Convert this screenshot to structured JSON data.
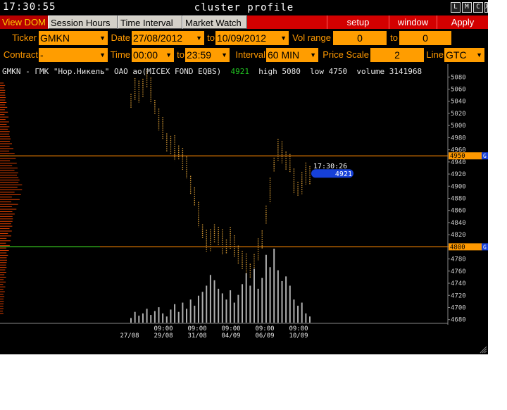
{
  "titlebar": {
    "clock": "17:30:55",
    "title": "cluster profile",
    "buttons": [
      "L",
      "M",
      "C",
      "X"
    ]
  },
  "menu": {
    "tabs": [
      "View DOM",
      "Session Hours",
      "Time Interval",
      "Market Watch"
    ],
    "right": [
      "setup",
      "window",
      "Apply"
    ]
  },
  "params": {
    "ticker_label": "Ticker",
    "ticker": "GMKN",
    "date_label": "Date",
    "date_from": "27/08/2012",
    "to_label": "to",
    "date_to": "10/09/2012",
    "vol_range_label": "Vol range",
    "vol_from": "0",
    "vol_to_label": "to",
    "vol_to": "0",
    "contract_label": "Contract",
    "contract": "-",
    "time_label": "Time",
    "time_from": "00:00",
    "time_to_label": "to",
    "time_to": "23:59",
    "interval_label": "Interval",
    "interval": "60 MIN",
    "price_scale_label": "Price Scale",
    "price_scale": "2",
    "line_label": "Line",
    "line": "GTC"
  },
  "info": {
    "instrument": "GMKN - ГМК \"Нор.Никель\" ОАО ао(MICEX FOND EQBS)",
    "last_price": "4921",
    "high_label": "high",
    "high": "5080",
    "low_label": "low",
    "low": "4750",
    "volume_label": "volume",
    "volume": "3141968"
  },
  "colors": {
    "accent": "#ff9900",
    "menu_red": "#d30000",
    "cursor_blue": "#1640d8",
    "line_orange": "#e07800",
    "green": "#20c020"
  },
  "chart_data": {
    "type": "line",
    "y_axis": {
      "ticks": [
        4680,
        4700,
        4720,
        4740,
        4760,
        4780,
        4800,
        4820,
        4840,
        4860,
        4880,
        4900,
        4920,
        4940,
        4960,
        4980,
        5000,
        5020,
        5040,
        5060,
        5080
      ],
      "range": [
        4675,
        5085
      ]
    },
    "x_tick_labels": [
      {
        "top": "",
        "bottom": "27/08"
      },
      {
        "top": "09:00",
        "bottom": "29/08"
      },
      {
        "top": "09:00",
        "bottom": "31/08"
      },
      {
        "top": "09:00",
        "bottom": "04/09"
      },
      {
        "top": "09:00",
        "bottom": "06/09"
      },
      {
        "top": "09:00",
        "bottom": "10/09"
      }
    ],
    "lines": [
      {
        "price": 4950,
        "label": "4950",
        "color": "#e07800"
      },
      {
        "price": 4800,
        "label": "4800",
        "color": "#e07800"
      }
    ],
    "cursor": {
      "time": "17:30:26",
      "price": "4921",
      "price_value": 4921
    },
    "grid_letter": "G",
    "price_series": [
      5040,
      5060,
      5050,
      5065,
      5075,
      5055,
      5030,
      5010,
      4990,
      4975,
      4965,
      4960,
      4955,
      4945,
      4925,
      4905,
      4880,
      4850,
      4825,
      4810,
      4805,
      4825,
      4815,
      4805,
      4800,
      4815,
      4795,
      4790,
      4775,
      4765,
      4760,
      4770,
      4790,
      4815,
      4850,
      4890,
      4935,
      4960,
      4950,
      4945,
      4935,
      4905,
      4895,
      4905,
      4915,
      4921
    ],
    "volume_series": [
      6,
      14,
      9,
      12,
      18,
      10,
      15,
      20,
      12,
      8,
      17,
      24,
      14,
      26,
      18,
      30,
      22,
      35,
      40,
      48,
      62,
      55,
      44,
      38,
      30,
      42,
      26,
      36,
      50,
      64,
      48,
      70,
      44,
      58,
      88,
      72,
      96,
      68,
      54,
      60,
      48,
      30,
      22,
      26,
      12,
      8
    ]
  }
}
